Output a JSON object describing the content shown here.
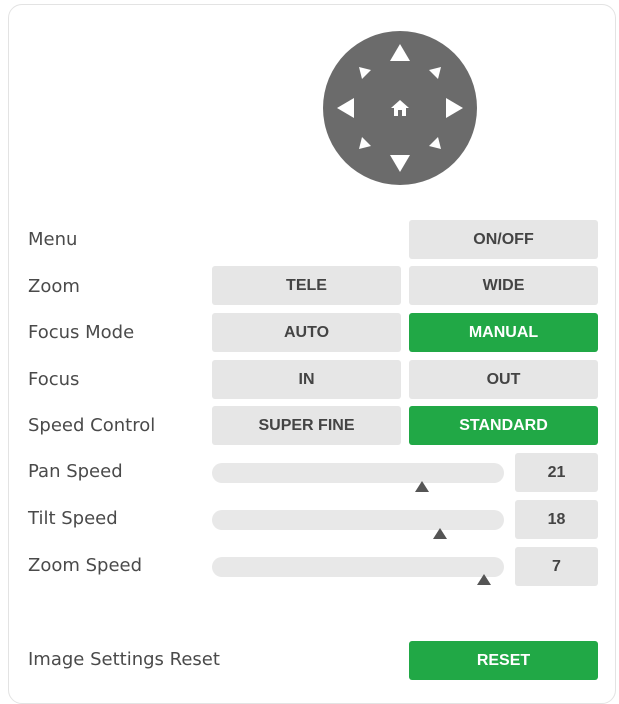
{
  "dpad": {
    "up_icon": "arrow-up-icon",
    "down_icon": "arrow-down-icon",
    "left_icon": "arrow-left-icon",
    "right_icon": "arrow-right-icon",
    "upleft_icon": "arrow-up-left-icon",
    "upright_icon": "arrow-up-right-icon",
    "downleft_icon": "arrow-down-left-icon",
    "downright_icon": "arrow-down-right-icon",
    "home_icon": "home-icon",
    "color": "#6b6b6b"
  },
  "rows": {
    "menu": {
      "label": "Menu",
      "button": "ON/OFF"
    },
    "zoom": {
      "label": "Zoom",
      "tele": "TELE",
      "wide": "WIDE"
    },
    "focus_mode": {
      "label": "Focus Mode",
      "auto": "AUTO",
      "manual": "MANUAL",
      "selected": "MANUAL"
    },
    "focus": {
      "label": "Focus",
      "in": "IN",
      "out": "OUT"
    },
    "speed_control": {
      "label": "Speed Control",
      "super_fine": "SUPER FINE",
      "standard": "STANDARD",
      "selected": "STANDARD"
    }
  },
  "sliders": {
    "pan": {
      "label": "Pan Speed",
      "value": "21",
      "fraction": 0.72
    },
    "tilt": {
      "label": "Tilt Speed",
      "value": "18",
      "fraction": 0.78
    },
    "zoom": {
      "label": "Zoom Speed",
      "value": "7",
      "fraction": 0.93
    }
  },
  "reset": {
    "label": "Image Settings Reset",
    "button": "RESET"
  },
  "colors": {
    "accent": "#21a846",
    "button_bg": "#e6e6e6",
    "track": "#e8e8e8"
  }
}
